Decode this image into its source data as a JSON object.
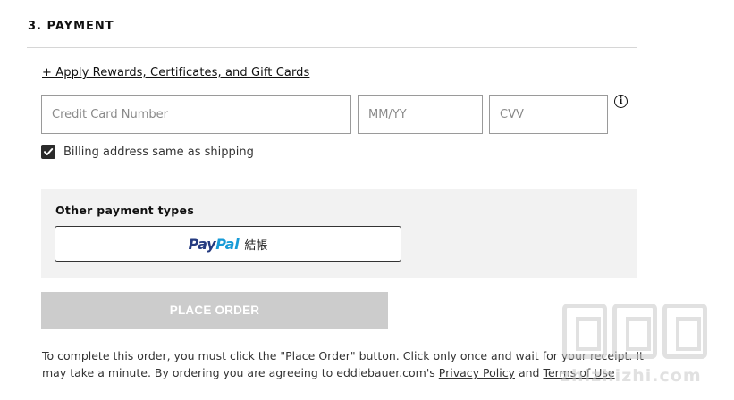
{
  "section": {
    "title": "3. PAYMENT"
  },
  "rewards": {
    "link_label": "+ Apply Rewards, Certificates, and Gift Cards"
  },
  "card_fields": {
    "number": {
      "placeholder": "Credit Card Number",
      "value": ""
    },
    "expiry": {
      "placeholder": "MM/YY",
      "value": ""
    },
    "cvv": {
      "placeholder": "CVV",
      "value": ""
    },
    "info_icon": "info-icon"
  },
  "billing": {
    "checked": true,
    "label": "Billing address same as shipping"
  },
  "other_payment": {
    "title": "Other payment types",
    "paypal": {
      "pay": "Pay",
      "pal": "Pal",
      "suffix": "結帳"
    }
  },
  "place_order": {
    "label": "PLACE ORDER"
  },
  "legal": {
    "text_before": "To complete this order, you must click the \"Place Order\" button. Click only once and wait for your receipt. It may take a minute. By ordering you are agreeing to eddiebauer.com's ",
    "privacy_label": "Privacy Policy",
    "and": " and ",
    "terms_label": "Terms of Use"
  },
  "watermark": {
    "text": "zhizhizhi.com"
  },
  "colors": {
    "paypal_dark": "#253b80",
    "paypal_light": "#179bd7",
    "disabled_button": "#cccccc",
    "panel_bg": "#f2f2f2"
  }
}
